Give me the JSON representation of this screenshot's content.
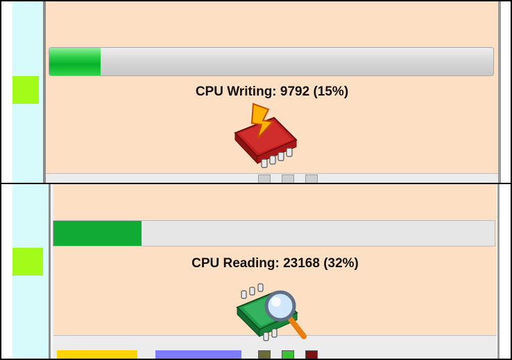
{
  "panels": [
    {
      "id": "top",
      "status_label": "CPU Writing:",
      "status_value": "9792 (15%)",
      "progress": 0.115,
      "icon": "cpu-write-icon"
    },
    {
      "id": "bottom",
      "status_label": "CPU Reading:",
      "status_value": "23168 (32%)",
      "progress": 0.2,
      "icon": "cpu-read-icon"
    }
  ],
  "colors": {
    "content_bg": "#fddfc3",
    "sidebar_cyan": "#d7fbfb",
    "sidebar_green": "#a3fb1a",
    "progress_green": "#0fab35",
    "legend_yellow": "#ffd300",
    "legend_blue": "#7f7cff"
  }
}
